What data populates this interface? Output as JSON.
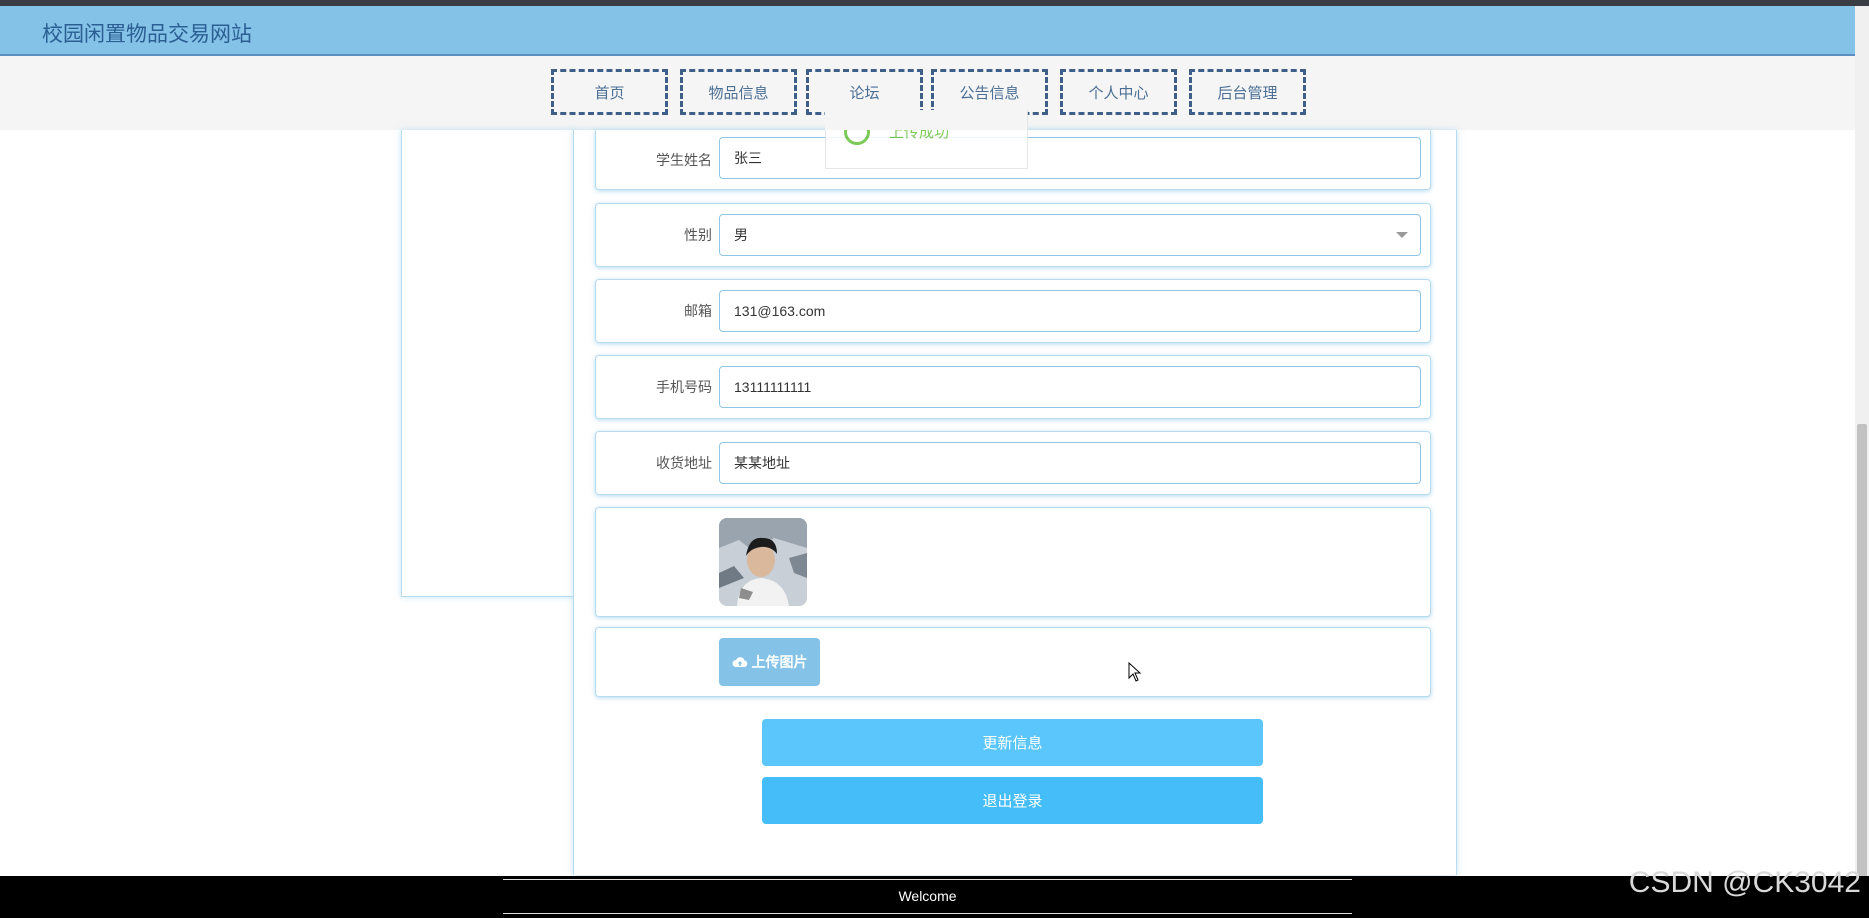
{
  "header": {
    "site_title": "校园闲置物品交易网站"
  },
  "nav": {
    "items": [
      {
        "label": "首页"
      },
      {
        "label": "物品信息"
      },
      {
        "label": "论坛"
      },
      {
        "label": "公告信息"
      },
      {
        "label": "个人中心"
      },
      {
        "label": "后台管理"
      }
    ]
  },
  "toast": {
    "text": "上传成功"
  },
  "form": {
    "name_label": "学生姓名",
    "name_value": "张三",
    "gender_label": "性别",
    "gender_value": "男",
    "email_label": "邮箱",
    "email_value": "131@163.com",
    "phone_label": "手机号码",
    "phone_value": "13111111111",
    "address_label": "收货地址",
    "address_value": "某某地址",
    "upload_label": "上传图片"
  },
  "actions": {
    "update_label": "更新信息",
    "logout_label": "退出登录"
  },
  "footer": {
    "text": "Welcome"
  },
  "watermark": "CSDN @CK3042",
  "colors": {
    "header_bg": "#85c2e8",
    "primary_button": "#5ac6fb",
    "logout_button": "#44bdf8",
    "border": "#b7dcf2"
  },
  "icons": {
    "upload": "cloud-upload-icon",
    "select": "chevron-down-icon",
    "success": "check-circle-icon"
  }
}
